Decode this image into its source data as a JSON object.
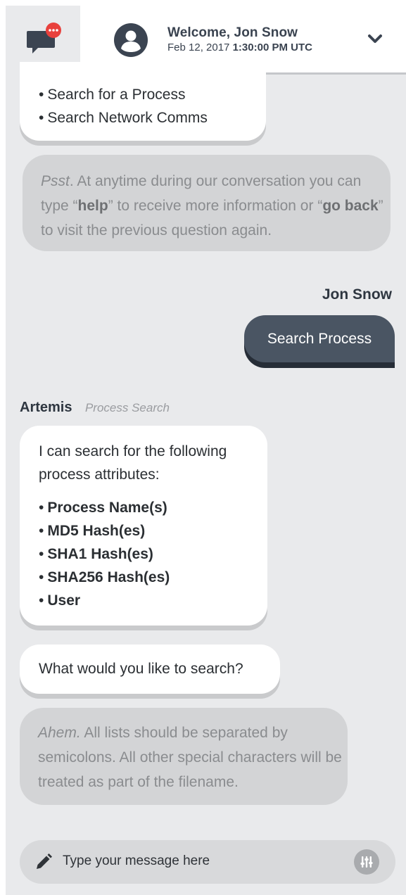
{
  "header": {
    "welcome": "Welcome, Jon Snow",
    "date": "Feb 12, 2017",
    "time": "1:30:00 PM UTC",
    "chat_icon": "chat-bubble-icon",
    "notification_icon": "ellipsis-badge-icon",
    "avatar_icon": "user-avatar-icon",
    "menu_icon": "chevron-down-icon"
  },
  "messages": {
    "bot_options": [
      "Search for a Process",
      "Search Network Comms"
    ],
    "bullet": "•",
    "tip1": {
      "lead": "Psst",
      "text1": ". At anytime during our conversation you can type “",
      "kw1": "help",
      "text2": "” to receive more information or “",
      "kw2": "go back",
      "text3": "” to visit the previous question again."
    },
    "user_name": "Jon Snow",
    "user_message": "Search Process",
    "bot_name": "Artemis",
    "bot_context": "Process Search",
    "attributes_intro": "I can search for the following process attributes:",
    "attributes": [
      "Process Name(s)",
      "MD5 Hash(es)",
      "SHA1 Hash(es)",
      "SHA256 Hash(es)",
      "User"
    ],
    "question": "What would you like to search?",
    "tip2": {
      "lead": "Ahem.",
      "text": " All lists should be separated by semicolons. All other special characters will be treated as part of the filename."
    }
  },
  "composer": {
    "placeholder": "Type your message here",
    "pencil_icon": "pencil-icon",
    "action_icon": "sliders-icon"
  },
  "colors": {
    "background": "#e9eaec",
    "header": "#ffffff",
    "user_bubble": "#4a5563",
    "notification": "#e8413d",
    "text_dark": "#3a4350"
  }
}
